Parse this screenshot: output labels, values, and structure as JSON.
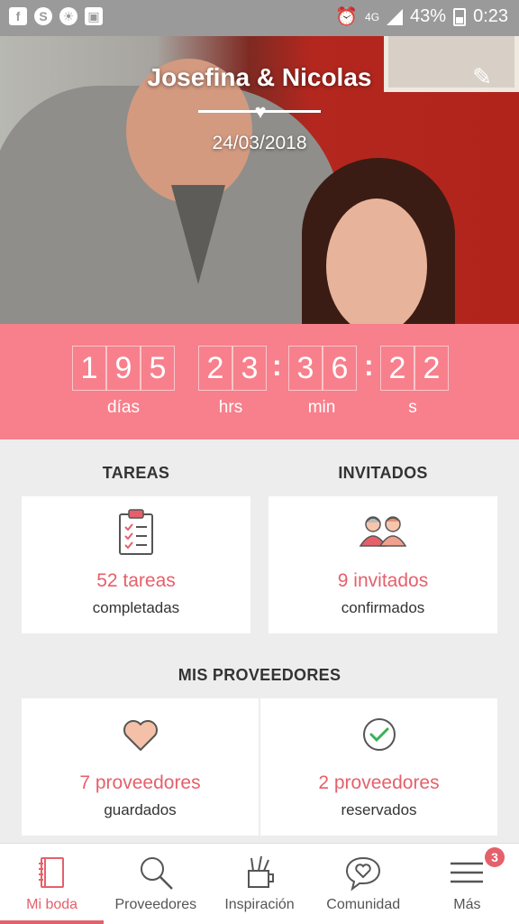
{
  "status_bar": {
    "battery": "43%",
    "time": "0:23",
    "network": "4G"
  },
  "hero": {
    "couple_names": "Josefina & Nicolas",
    "wedding_date": "24/03/2018"
  },
  "countdown": {
    "days": [
      "1",
      "9",
      "5"
    ],
    "hours": [
      "2",
      "3"
    ],
    "minutes": [
      "3",
      "6"
    ],
    "seconds": [
      "2",
      "2"
    ],
    "labels": {
      "days": "días",
      "hours": "hrs",
      "minutes": "min",
      "seconds": "s"
    }
  },
  "tasks": {
    "title": "TAREAS",
    "stat": "52 tareas",
    "sub": "completadas"
  },
  "guests": {
    "title": "INVITADOS",
    "stat": "9 invitados",
    "sub": "confirmados"
  },
  "vendors": {
    "title": "MIS PROVEEDORES",
    "saved": {
      "stat": "7 proveedores",
      "sub": "guardados"
    },
    "booked": {
      "stat": "2 proveedores",
      "sub": "reservados"
    }
  },
  "bottom_nav": {
    "items": [
      {
        "label": "Mi boda",
        "icon": "notebook-icon",
        "active": true
      },
      {
        "label": "Proveedores",
        "icon": "search-icon"
      },
      {
        "label": "Inspiración",
        "icon": "pencil-cup-icon"
      },
      {
        "label": "Comunidad",
        "icon": "chat-heart-icon"
      },
      {
        "label": "Más",
        "icon": "menu-icon",
        "badge": "3"
      }
    ]
  },
  "colors": {
    "accent": "#e5606b",
    "countdown_bg": "#f7808c",
    "page_bg": "#ededed"
  }
}
